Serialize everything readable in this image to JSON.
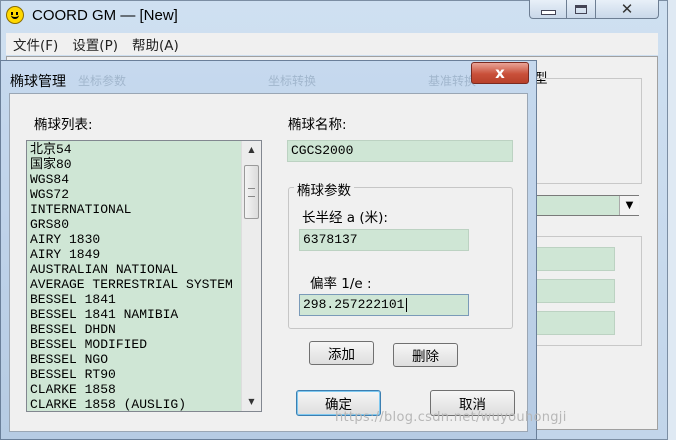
{
  "main_window": {
    "title": "COORD GM — [New]",
    "menu": [
      "文件(F)",
      "设置(P)",
      "帮助(A)"
    ],
    "caption_buttons": {
      "close": "✕"
    },
    "right_label": "型"
  },
  "background_tabs": [
    "坐标参数",
    "坐标转换",
    "基准转换"
  ],
  "dialog": {
    "title": "椭球管理",
    "close_glyph": "x",
    "list_label": "椭球列表:",
    "ellipsoids": [
      "北京54",
      "国家80",
      "WGS84",
      "WGS72",
      "INTERNATIONAL",
      "GRS80",
      "AIRY 1830",
      "AIRY 1849",
      "AUSTRALIAN NATIONAL",
      "AVERAGE TERRESTRIAL SYSTEM",
      "BESSEL 1841",
      "BESSEL 1841 NAMIBIA",
      "BESSEL DHDN",
      "BESSEL MODIFIED",
      "BESSEL NGO",
      "BESSEL RT90",
      "CLARKE 1858",
      "CLARKE 1858 (AUSLIG)"
    ],
    "name_label": "椭球名称:",
    "name_value": "CGCS2000",
    "params_title": "椭球参数",
    "semi_major_label": "长半经 a (米):",
    "semi_major_value": "6378137",
    "flattening_label": "偏率 1/e :",
    "flattening_value": "298.257222101",
    "add_button": "添加",
    "delete_button": "删除",
    "ok_button": "确定",
    "cancel_button": "取消"
  },
  "watermark": "https://blog.csdn.net/wuyouhongji",
  "icons": {
    "app": "smiley-icon",
    "scroll_up": "scroll-up-icon",
    "scroll_down": "scroll-down-icon",
    "dropdown": "dropdown-arrow-icon"
  },
  "colors": {
    "field_green": "#cfe6d5",
    "dialog_close_red": "#c9503a",
    "frame_blue": "#c2d5ea"
  }
}
